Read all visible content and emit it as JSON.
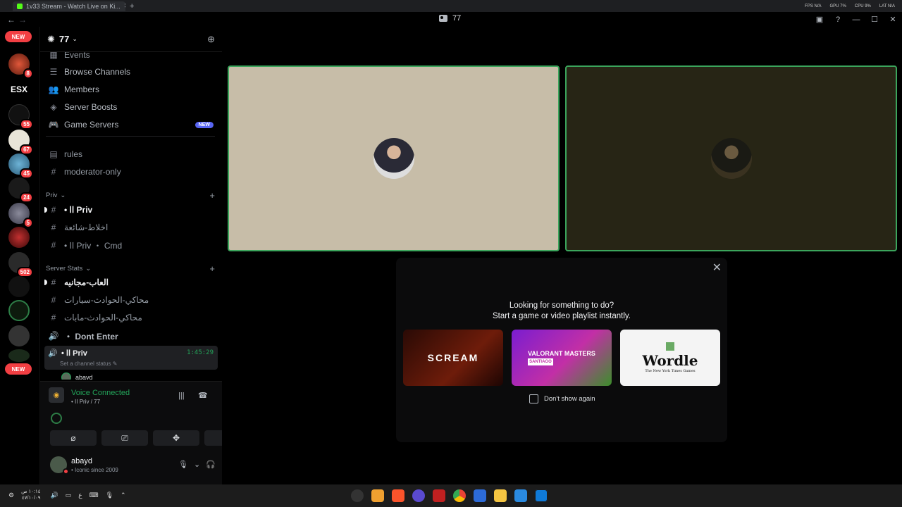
{
  "browser": {
    "tab_title": "1v33 Stream - Watch Live on Ki...",
    "new_tab": "+",
    "stats": [
      "FPS N/A",
      "GPU 7%",
      "CPU 9%",
      "LAT N/A"
    ]
  },
  "window": {
    "title": "77"
  },
  "guilds": {
    "badges": [
      "8",
      "55",
      "67",
      "45",
      "24",
      "5",
      "502"
    ],
    "new_label": "NEW",
    "esx_label": "ESX"
  },
  "server": {
    "name": "77",
    "items": [
      {
        "label": "Events",
        "icon": "calendar-icon"
      },
      {
        "label": "Browse Channels",
        "icon": "list-icon"
      },
      {
        "label": "Members",
        "icon": "members-icon"
      },
      {
        "label": "Server Boosts",
        "icon": "boost-icon"
      },
      {
        "label": "Game Servers",
        "icon": "gamepad-icon",
        "pill": "NEW"
      }
    ],
    "channels_top": [
      {
        "label": "rules",
        "icon": "rules-icon"
      },
      {
        "label": "moderator-only",
        "icon": "hash-icon"
      }
    ],
    "cat_priv": "Priv",
    "priv_channels": [
      {
        "label": "• اا Priv",
        "bold": true
      },
      {
        "label": "اخلاط-شائعة",
        "bold": false
      },
      {
        "label": "• اا Priv ・ Cmd",
        "bold": false
      }
    ],
    "cat_stats": "Server Stats",
    "stats_channels": [
      {
        "label": "العاب-مجانيه",
        "bold": true
      },
      {
        "label": "محاكي-الحوادث-سيارات",
        "bold": false
      },
      {
        "label": "محاكي-الحوادث-مابات",
        "bold": false
      }
    ],
    "voice_dont_enter": "・ Dont Enter",
    "active_voice": {
      "name": "• اا Priv",
      "timer": "1:45:29",
      "status": "Set a channel status"
    },
    "voice_user": "abayd"
  },
  "voice_panel": {
    "title": "Voice Connected",
    "subtitle": "• اا Priv / 77"
  },
  "user": {
    "name": "abayd",
    "status": "• Iconic since 2009"
  },
  "popup": {
    "line1": "Looking for something to do?",
    "line2": "Start a game or video playlist instantly.",
    "cards": {
      "scream": "SCREAM",
      "valorant": "VALORANT MASTERS",
      "valorant_sub": "SANTIAGO",
      "wordle": "Wordle",
      "wordle_sub": "The New York Times Games"
    },
    "checkbox_label": "Don't show again"
  },
  "taskbar": {
    "time": "١٠:١٤ ص",
    "date": "٤٧/١٠/٠٩",
    "lang": "ع"
  },
  "colors": {
    "accent_green": "#23a55a",
    "danger_red": "#f23f43",
    "blurple": "#5865f2"
  }
}
